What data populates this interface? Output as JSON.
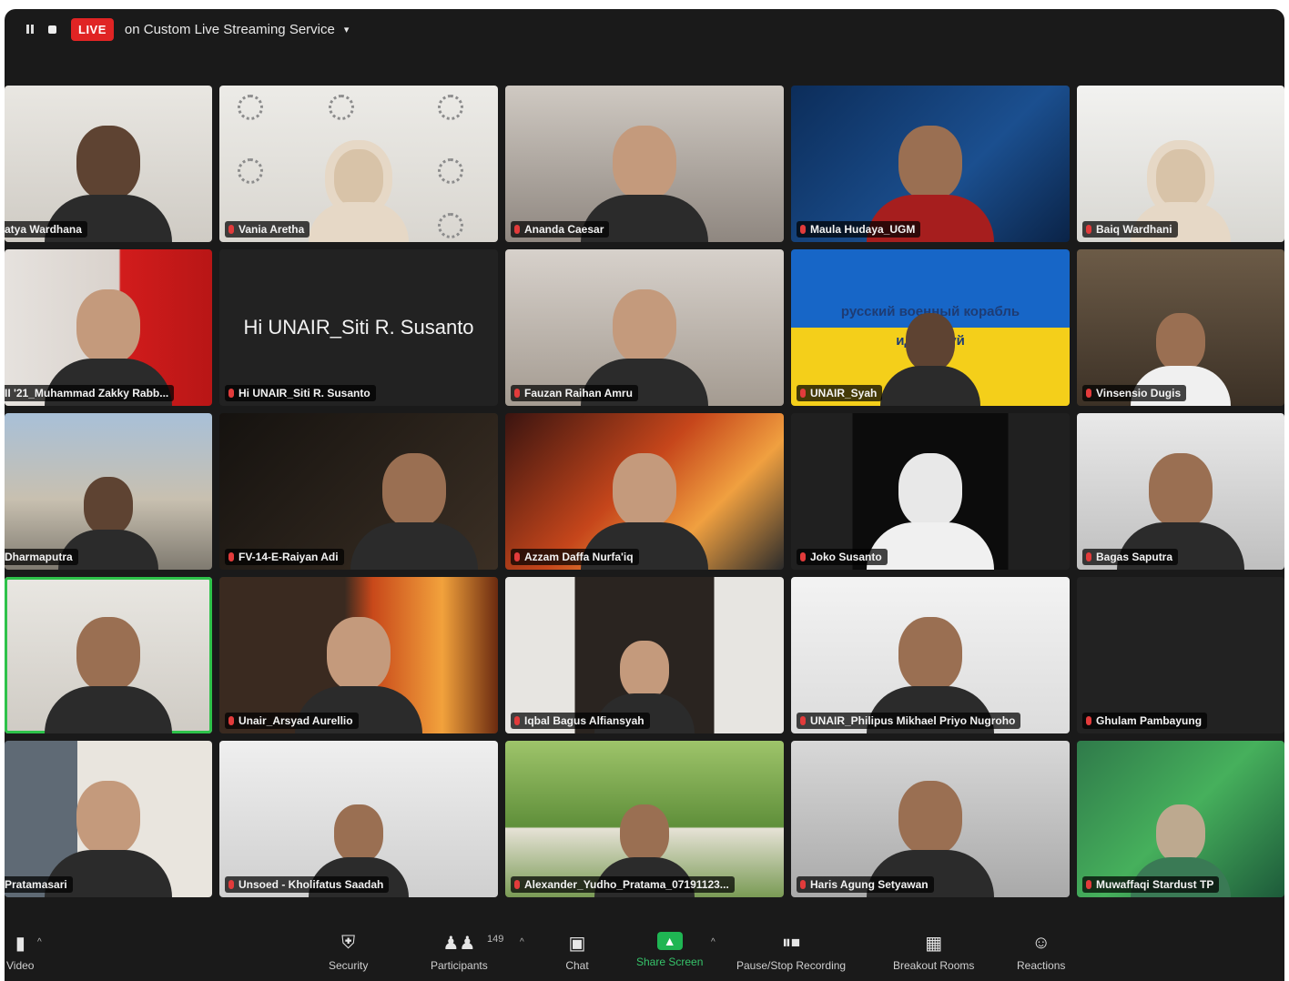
{
  "topbar": {
    "live_badge": "LIVE",
    "stream_label": "on Custom Live Streaming Service",
    "stream_caret": "▾"
  },
  "grid": {
    "bigname": "Hi UNAIR_Siti R. Susanto",
    "ukr_line1": "русский военный корабль",
    "ukr_line2": "иди нахуй",
    "tiles": [
      "atya Wardhana",
      "Vania Aretha",
      "Ananda Caesar",
      "Maula Hudaya_UGM",
      "Baiq Wardhani",
      "II '21_Muhammad Zakky Rabb...",
      "Hi UNAIR_Siti R. Susanto",
      "Fauzan Raihan Amru",
      "UNAIR_Syah",
      "Vinsensio Dugis",
      "Dharmaputra",
      "FV-14-E-Raiyan Adi",
      "Azzam Daffa Nurfa'iq",
      "Joko Susanto",
      "Bagas Saputra",
      "",
      "Unair_Arsyad Aurellio",
      "Iqbal Bagus Alfiansyah",
      "UNAIR_Philipus Mikhael Priyo Nugroho",
      "Ghulam Pambayung",
      "Pratamasari",
      "Unsoed - Kholifatus Saadah",
      "Alexander_Yudho_Pratama_07191123...",
      "Haris Agung Setyawan",
      "Muwaffaqi Stardust TP"
    ]
  },
  "toolbar": {
    "video": "Video",
    "security": "Security",
    "participants": "Participants",
    "participants_count": "149",
    "chat": "Chat",
    "share": "Share Screen",
    "recording": "Pause/Stop Recording",
    "breakout": "Breakout Rooms",
    "reactions": "Reactions"
  },
  "icons": {
    "video": "video-camera-icon",
    "security": "shield-icon",
    "participants": "people-icon",
    "chat": "speech-bubble-icon",
    "share": "share-screen-icon",
    "recording": "pause-stop-icon",
    "breakout": "grid-squares-icon",
    "reactions": "smiley-icon"
  },
  "colors": {
    "live": "#e02424",
    "share": "#1fb553",
    "active_speaker": "#2ec24a"
  }
}
